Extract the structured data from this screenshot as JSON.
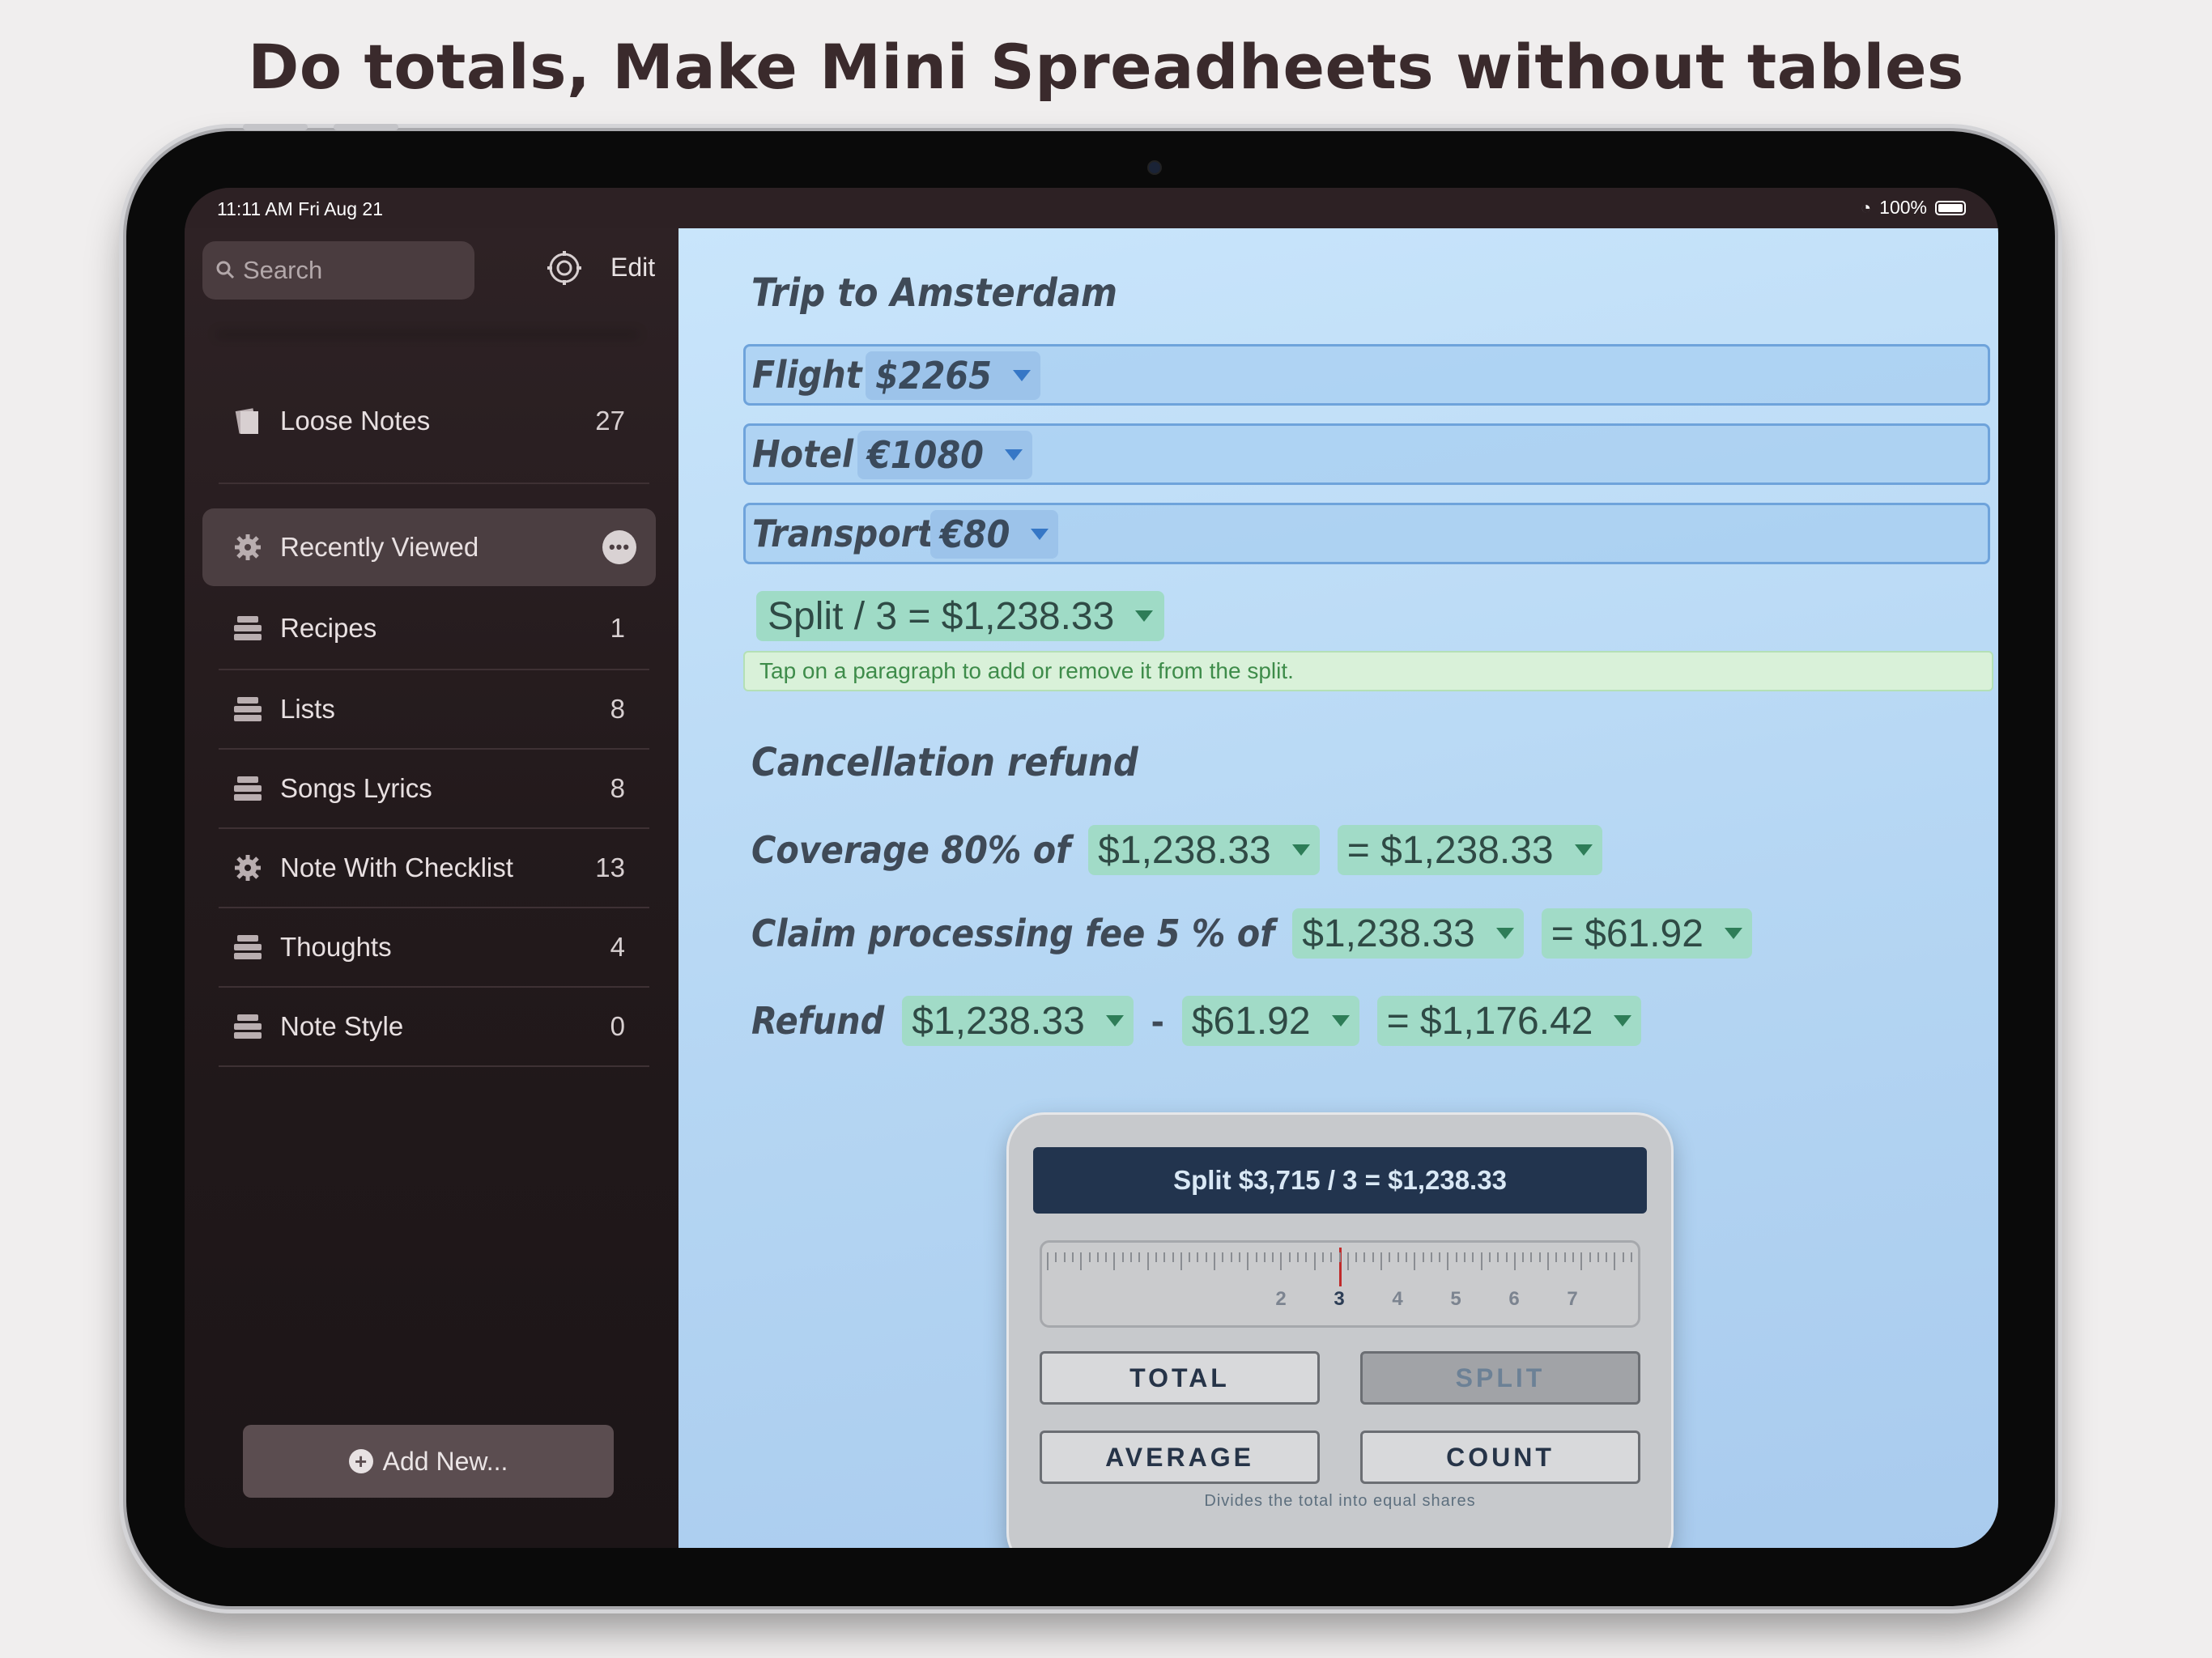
{
  "headline": "Do totals, Make Mini Spreadheets without tables",
  "status": {
    "time": "11:11 AM   Fri Aug 21",
    "battery": "100%"
  },
  "sidebar": {
    "search_placeholder": "Search",
    "edit_label": "Edit",
    "items": [
      {
        "label": "Loose Notes",
        "count": "27",
        "icon": "notes-icon"
      },
      {
        "label": "Recently Viewed",
        "count": "",
        "icon": "gear-icon",
        "selected": true
      },
      {
        "label": "Recipes",
        "count": "1",
        "icon": "stack-icon"
      },
      {
        "label": "Lists",
        "count": "8",
        "icon": "stack-icon"
      },
      {
        "label": "Songs Lyrics",
        "count": "8",
        "icon": "stack-icon"
      },
      {
        "label": "Note With Checklist",
        "count": "13",
        "icon": "gear-icon"
      },
      {
        "label": "Thoughts",
        "count": "4",
        "icon": "stack-icon"
      },
      {
        "label": "Note Style",
        "count": "0",
        "icon": "stack-icon"
      }
    ],
    "add_new_label": "Add New..."
  },
  "note": {
    "title": "Trip to Amsterdam",
    "rows": [
      {
        "label": "Flight",
        "value": "$2265"
      },
      {
        "label": "Hotel",
        "value": "€1080"
      },
      {
        "label": "Transport",
        "value": "€80"
      }
    ],
    "split_result": "Split / 3 = $1,238.33",
    "hint": "Tap on a paragraph to add or remove it from the split.",
    "section_title": "Cancellation refund",
    "coverage": {
      "label": "Coverage 80% of",
      "operand": "$1,238.33",
      "result": "= $1,238.33"
    },
    "claim": {
      "label": "Claim processing fee 5 %  of",
      "operand": "$1,238.33",
      "result": "= $61.92"
    },
    "refund": {
      "label": "Refund",
      "a": "$1,238.33",
      "op": "-",
      "b": "$61.92",
      "result": "= $1,176.42"
    }
  },
  "calculator": {
    "display": "Split $3,715 / 3 = $1,238.33",
    "ruler_numbers": [
      "2",
      "3",
      "4",
      "5",
      "6",
      "7"
    ],
    "selected_divisor": "3",
    "buttons": {
      "total": "TOTAL",
      "split": "SPLIT",
      "average": "AVERAGE",
      "count": "COUNT"
    },
    "active_button": "SPLIT",
    "description": "Divides the total into equal shares"
  },
  "colors": {
    "accent_blue": "#3677c6",
    "accent_green": "#2e7d58",
    "needle": "#c02b2b"
  }
}
